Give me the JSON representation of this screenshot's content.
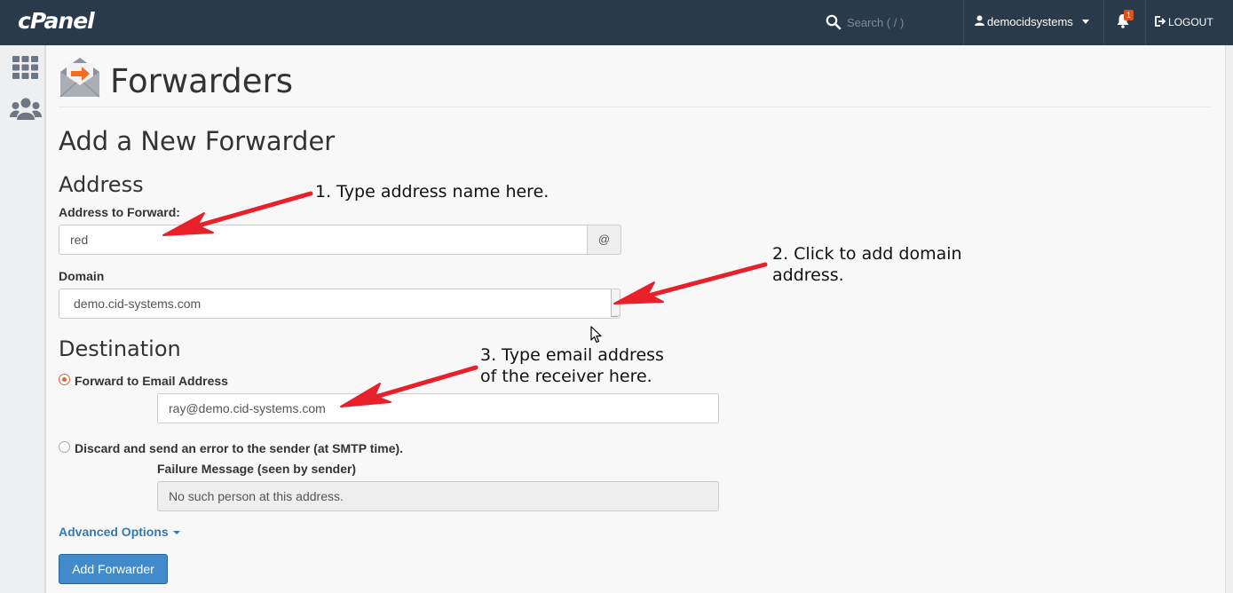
{
  "header": {
    "logo": "cPanel",
    "search_placeholder": "Search ( / )",
    "username": "democidsystems",
    "notification_count": "1",
    "logout_label": "LOGOUT"
  },
  "sidebar": {
    "icons": [
      "apps-grid-icon",
      "users-icon"
    ]
  },
  "page": {
    "title": "Forwarders",
    "section_title": "Add a New Forwarder",
    "address": {
      "heading": "Address",
      "address_label": "Address to Forward:",
      "address_value": "red",
      "at_symbol": "@",
      "domain_label": "Domain",
      "domain_value": "demo.cid-systems.com"
    },
    "destination": {
      "heading": "Destination",
      "forward_option_label": "Forward to Email Address",
      "forward_option_selected": true,
      "forward_email_value": "ray@demo.cid-systems.com",
      "discard_option_label": "Discard and send an error to the sender (at SMTP time).",
      "discard_option_selected": false,
      "failure_label": "Failure Message (seen by sender)",
      "failure_value": "No such person at this address."
    },
    "advanced_options_label": "Advanced Options",
    "add_button_label": "Add Forwarder"
  },
  "annotations": {
    "note1": "1. Type address name here.",
    "note2": "2. Click to add domain\naddress.",
    "note3": "3. Type email address\nof the receiver here.",
    "arrow_color": "#e8202a"
  },
  "colors": {
    "topbar": "#293a4a",
    "accent": "#e1653c",
    "link": "#337ab7",
    "primary_button": "#428bca"
  }
}
